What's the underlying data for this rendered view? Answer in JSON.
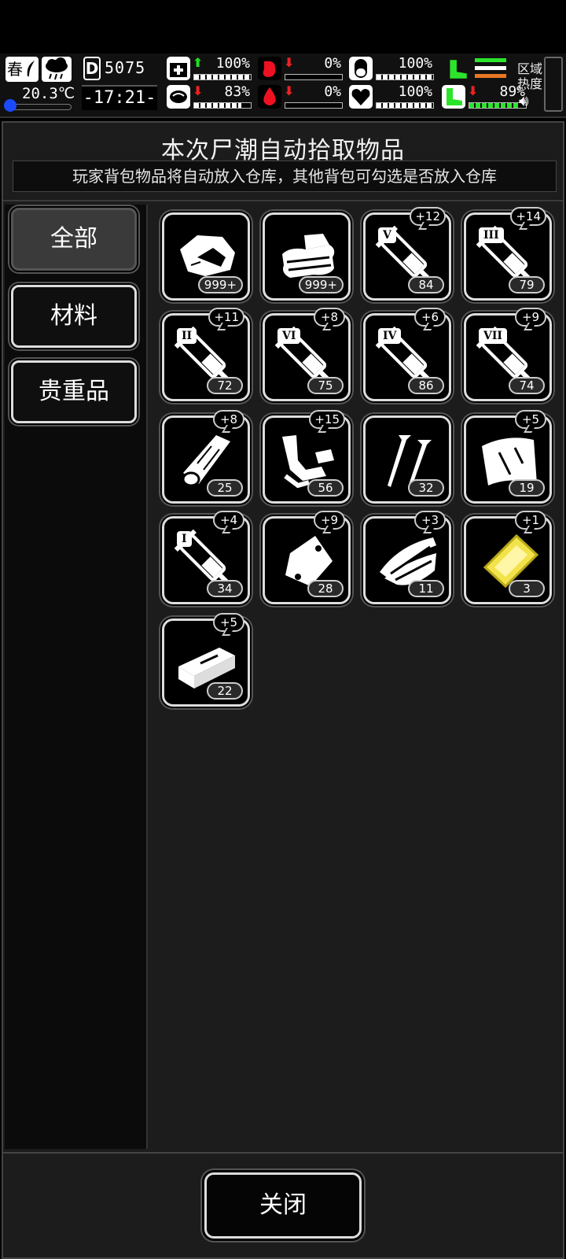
{
  "status": {
    "season": "春",
    "temperature": "20.3℃",
    "temperature_level": 0.05,
    "day_label": "D",
    "day_number": "5075",
    "clock": "-17:21-",
    "stats": [
      {
        "name": "health",
        "icon": "medkit-icon",
        "trend": "up",
        "value": "100%",
        "level": 1.0
      },
      {
        "name": "hunger",
        "icon": "stomach-icon",
        "trend": "down",
        "value": "0%",
        "level": 0.0
      },
      {
        "name": "mental",
        "icon": "capsule-icon",
        "trend": "none",
        "value": "100%",
        "level": 1.0
      },
      {
        "name": "brain",
        "icon": "brain-icon",
        "trend": "down",
        "value": "83%",
        "level": 0.83
      },
      {
        "name": "thirst",
        "icon": "blood-drop-icon",
        "trend": "down",
        "value": "0%",
        "level": 0.0
      },
      {
        "name": "heart",
        "icon": "heart-icon",
        "trend": "none",
        "value": "100%",
        "level": 1.0
      },
      {
        "name": "stamina",
        "icon": "boot-icon",
        "trend": "down",
        "value": "89%",
        "level": 0.89
      }
    ],
    "region_label_1": "区域",
    "region_label_2": "热度",
    "speaker_icon": "speaker-icon"
  },
  "panel": {
    "title": "本次尸潮自动拾取物品",
    "subtitle": "玩家背包物品将自动放入仓库，其他背包可勾选是否放入仓库"
  },
  "tabs": [
    {
      "label": "全部",
      "active": true
    },
    {
      "label": "材料",
      "active": false
    },
    {
      "label": "贵重品",
      "active": false
    }
  ],
  "items": [
    {
      "icon": "meat-icon",
      "count": "999+",
      "plus": ""
    },
    {
      "icon": "cloth-icon",
      "count": "999+",
      "plus": ""
    },
    {
      "icon": "syringe-icon",
      "roman": "V",
      "count": "84",
      "plus": "+12"
    },
    {
      "icon": "syringe-icon",
      "roman": "III",
      "count": "79",
      "plus": "+14"
    },
    {
      "icon": "syringe-icon",
      "roman": "II",
      "count": "72",
      "plus": "+11"
    },
    {
      "icon": "syringe-icon",
      "roman": "VI",
      "count": "75",
      "plus": "+8"
    },
    {
      "icon": "syringe-icon",
      "roman": "IV",
      "count": "86",
      "plus": "+6"
    },
    {
      "icon": "syringe-icon",
      "roman": "VII",
      "count": "74",
      "plus": "+9"
    },
    {
      "icon": "wood-log-icon",
      "count": "25",
      "plus": "+8"
    },
    {
      "icon": "scrap-pipe-icon",
      "count": "56",
      "plus": "+15"
    },
    {
      "icon": "nails-icon",
      "count": "32",
      "plus": ""
    },
    {
      "icon": "sheet-icon",
      "count": "19",
      "plus": "+5"
    },
    {
      "icon": "syringe-icon",
      "roman": "I",
      "count": "34",
      "plus": "+4"
    },
    {
      "icon": "plastic-bag-icon",
      "count": "28",
      "plus": "+9"
    },
    {
      "icon": "wood-planks-icon",
      "count": "11",
      "plus": "+3"
    },
    {
      "icon": "gold-bar-icon",
      "count": "3",
      "plus": "+1"
    },
    {
      "icon": "brick-icon",
      "count": "22",
      "plus": "+5"
    }
  ],
  "footer": {
    "close_label": "关闭"
  },
  "colors": {
    "accent_green": "#2be52b",
    "accent_red": "#ee2222",
    "gold": "#f2e34a"
  }
}
